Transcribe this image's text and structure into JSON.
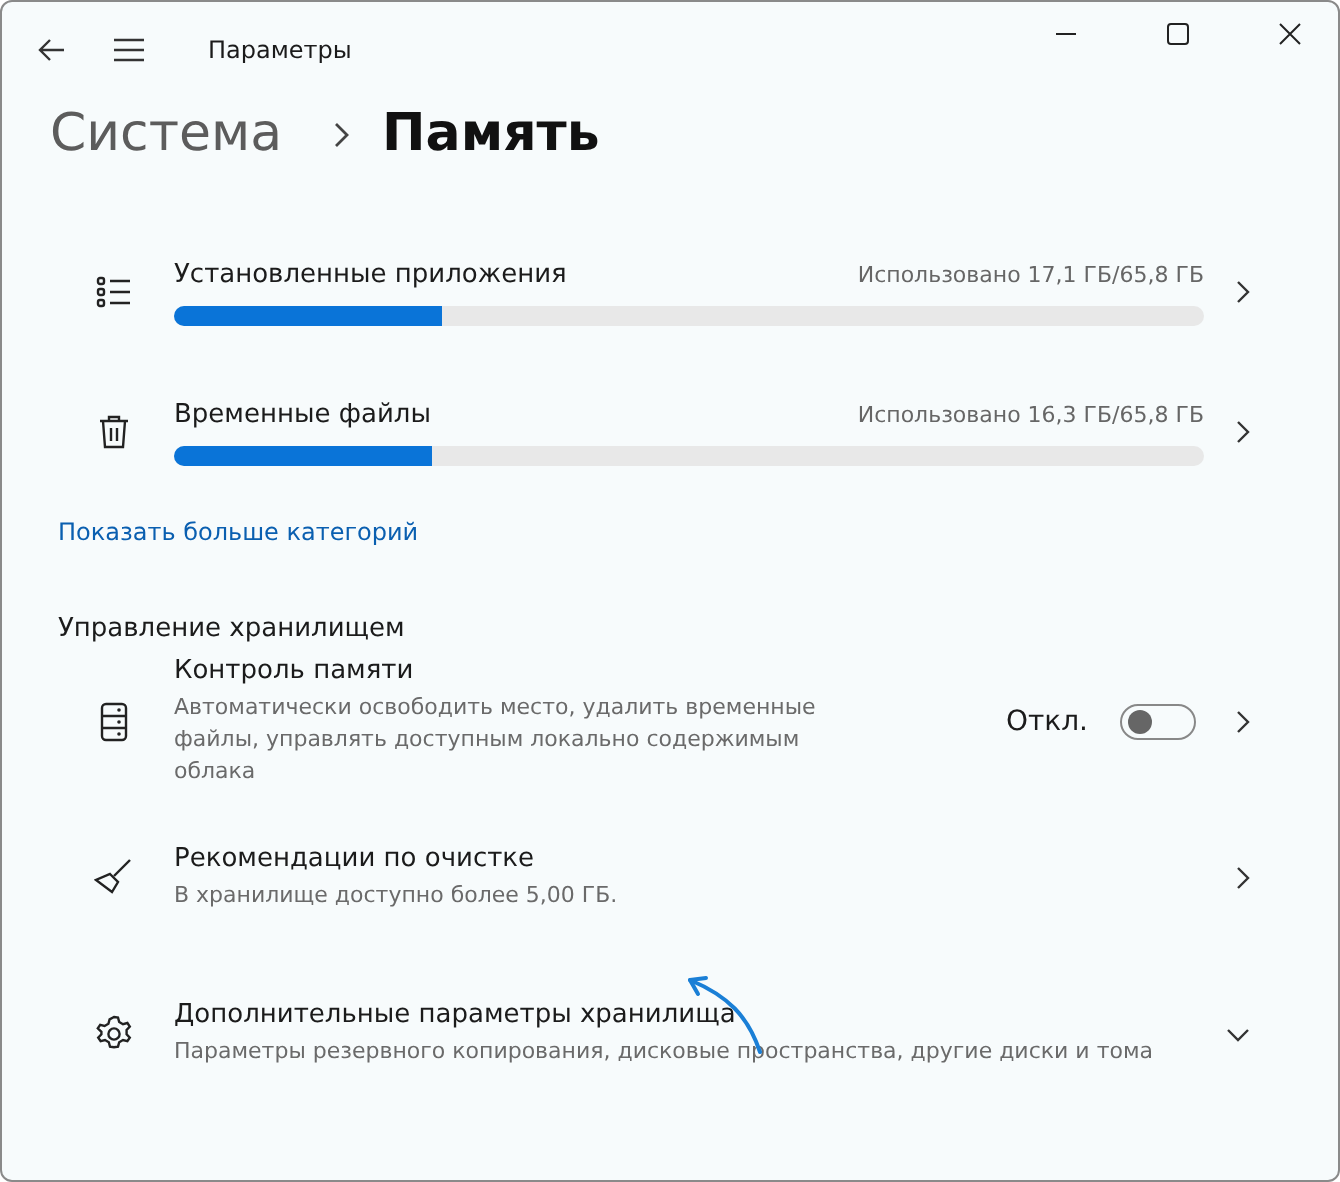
{
  "window": {
    "title": "Параметры"
  },
  "breadcrumb": {
    "parent": "Система",
    "current": "Память"
  },
  "categories": [
    {
      "label": "Установленные приложения",
      "usage": "Использовано 17,1 ГБ/65,8 ГБ",
      "level": 0.26
    },
    {
      "label": "Временные файлы",
      "usage": "Использовано 16,3 ГБ/65,8 ГБ",
      "level": 0.25
    }
  ],
  "show_more_link": "Показать больше категорий",
  "section_title": "Управление хранилищем",
  "settings": [
    {
      "kind": "toggle",
      "title": "Контроль памяти",
      "description": "Автоматически освободить место, удалить временные файлы, управлять доступным локально содержимым облака",
      "state_label": "Откл.",
      "on": false
    },
    {
      "kind": "link",
      "title": "Рекомендации по очистке",
      "description": "В хранилище доступно более 5,00 ГБ."
    },
    {
      "kind": "expand",
      "title": "Дополнительные параметры хранилища",
      "description": "Параметры резервного копирования, дисковые пространства, другие диски и тома"
    }
  ]
}
